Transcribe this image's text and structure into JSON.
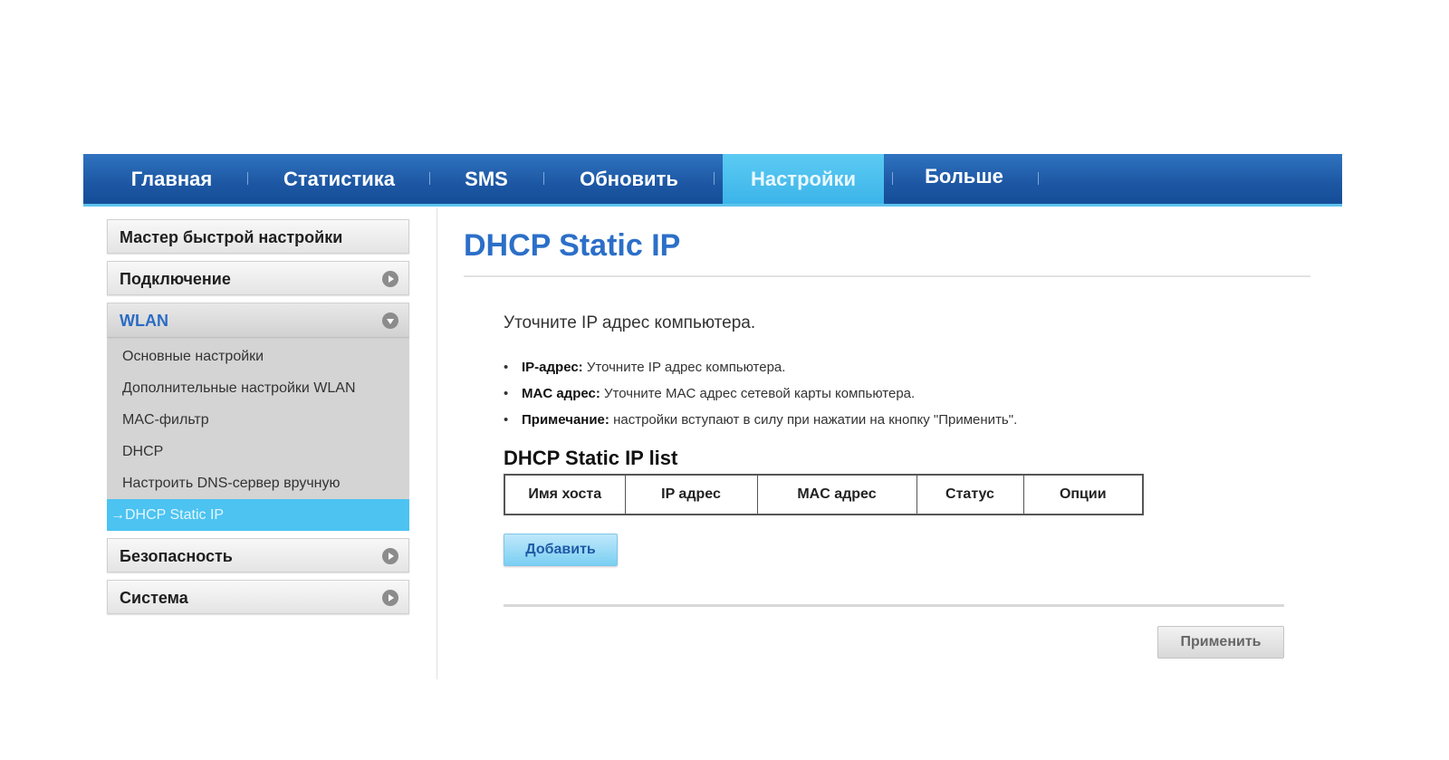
{
  "topnav": {
    "tabs": [
      {
        "label": "Главная"
      },
      {
        "label": "Статистика"
      },
      {
        "label": "SMS"
      },
      {
        "label": "Обновить"
      },
      {
        "label": "Настройки"
      },
      {
        "label": "Больше"
      }
    ],
    "active_tab": "Настройки"
  },
  "sidebar": {
    "quick_setup": "Мастер быстрой настройки",
    "connection": "Подключение",
    "wlan": "WLAN",
    "wlan_items": [
      {
        "label": "Основные настройки"
      },
      {
        "label": "Дополнительные настройки WLAN"
      },
      {
        "label": "MAC-фильтр"
      },
      {
        "label": "DHCP"
      },
      {
        "label": "Настроить DNS-сервер вручную"
      },
      {
        "label": "→DHCP Static IP"
      }
    ],
    "security": "Безопасность",
    "system": "Система"
  },
  "main": {
    "title": "DHCP Static IP",
    "intro": "Уточните IP адрес компьютера.",
    "bullets": [
      {
        "term": "IP-адрес:",
        "text": " Уточните IP адрес компьютера."
      },
      {
        "term": "MAC адрес:",
        "text": " Уточните MAC адрес сетевой карты компьютера."
      },
      {
        "term": "Примечание:",
        "text": " настройки вступают в силу при нажатии на кнопку \"Применить\"."
      }
    ],
    "list_title": "DHCP Static IP list",
    "table_headers": [
      "Имя хоста",
      "IP адрес",
      "MAC адрес",
      "Статус",
      "Опции"
    ],
    "add_button": "Добавить",
    "apply_button": "Применить"
  },
  "colors": {
    "nav_blue": "#1d57a3",
    "active_cyan": "#4cc3f1",
    "title_blue": "#2c6fc8"
  }
}
